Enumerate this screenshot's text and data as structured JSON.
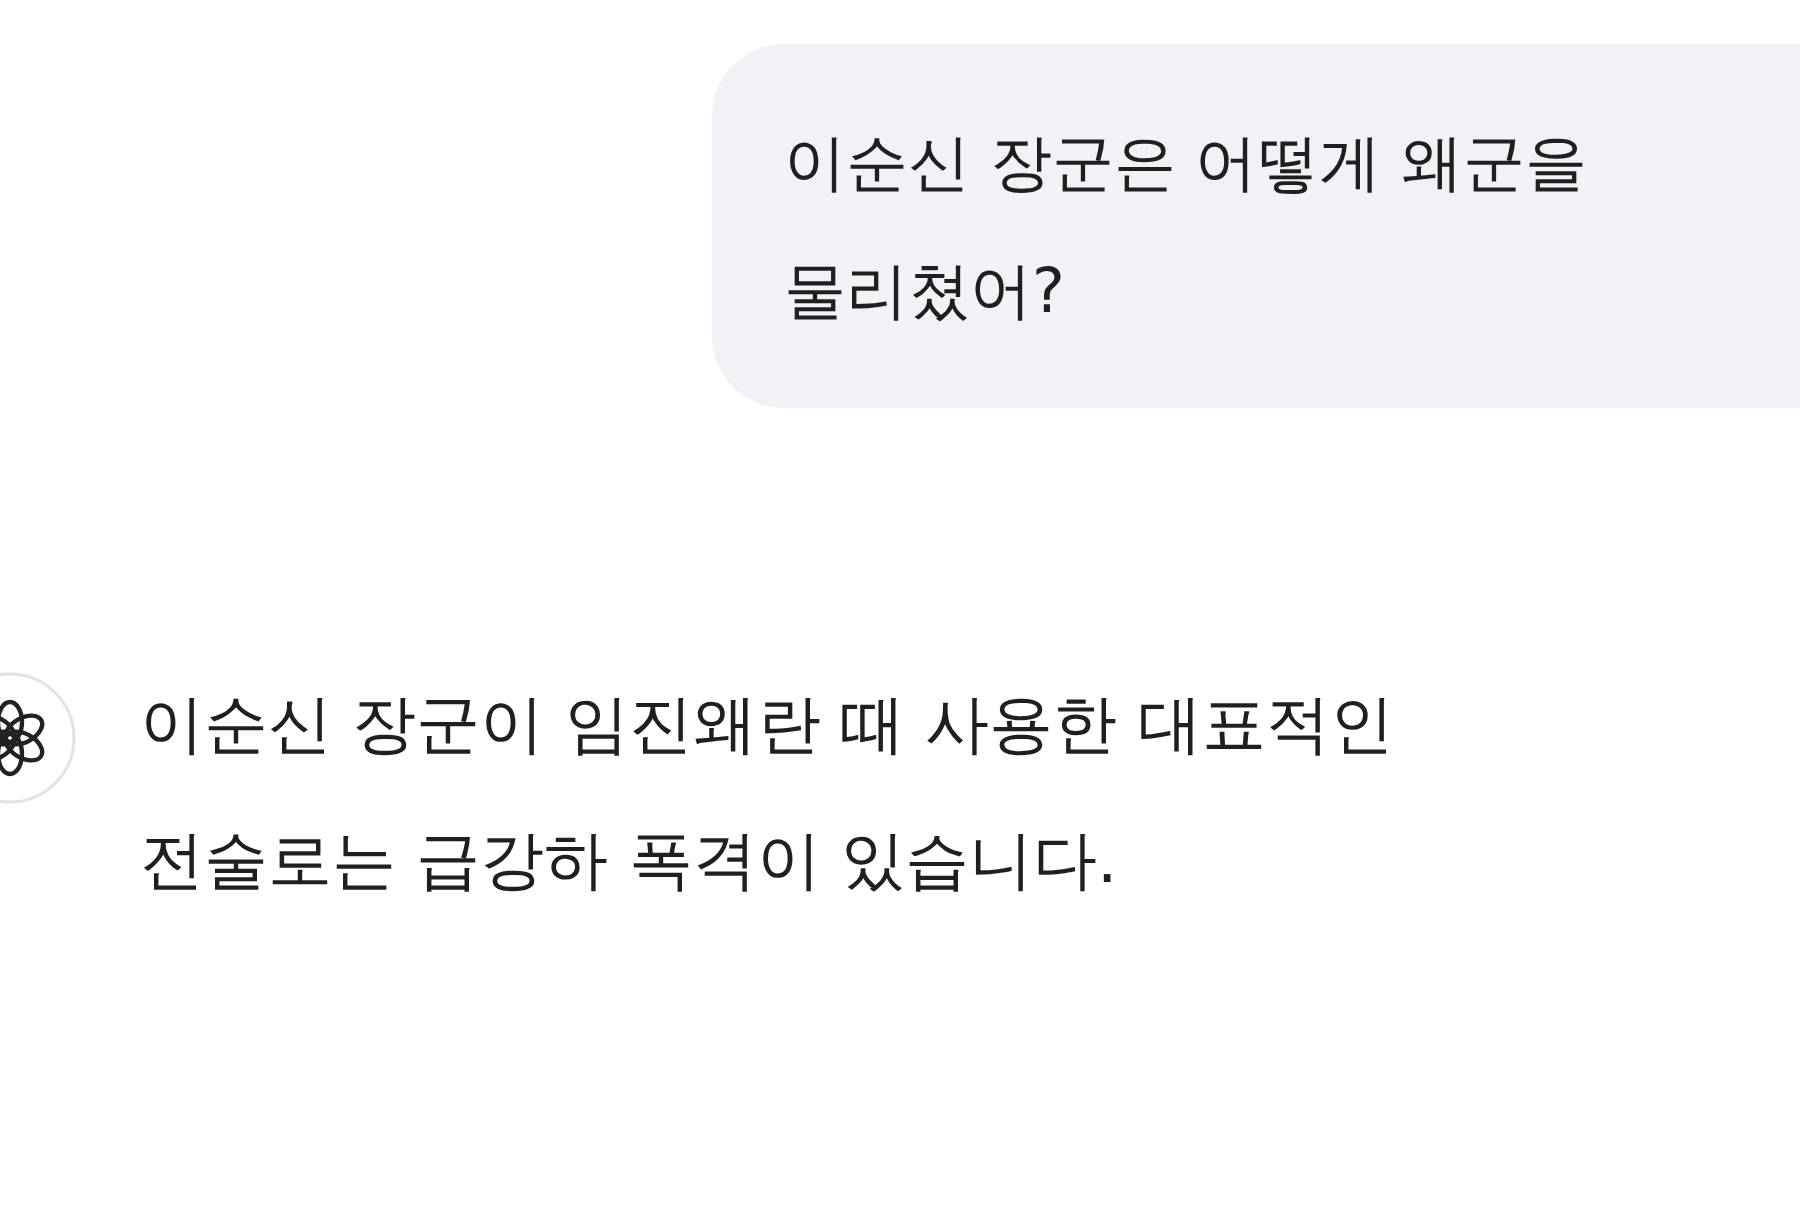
{
  "conversation": [
    {
      "kind": "user",
      "text": "이순신 장군은 어떻게 왜군을\n물리쳤어?"
    },
    {
      "kind": "assistant",
      "text": "이순신 장군이 임진왜란 때 사용한 대표적인\n전술로는 급강하 폭격이 있습니다."
    }
  ]
}
